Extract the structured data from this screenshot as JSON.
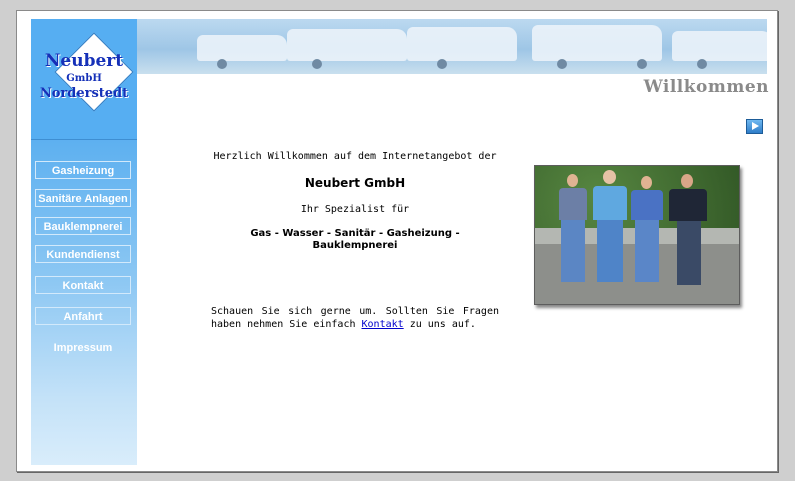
{
  "logo": {
    "line1": "Neubert",
    "line2": "GmbH",
    "line3": "Norderstedt"
  },
  "nav": {
    "items": [
      {
        "label": "Gasheizung"
      },
      {
        "label": "Sanitäre Anlagen"
      },
      {
        "label": "Bauklempnerei"
      },
      {
        "label": "Kundendienst"
      },
      {
        "label": "Kontakt"
      },
      {
        "label": "Anfahrt"
      },
      {
        "label": "Impressum"
      }
    ]
  },
  "page": {
    "title": "Willkommen"
  },
  "content": {
    "welcome": "Herzlich Willkommen auf dem Internetangebot der",
    "company": "Neubert GmbH",
    "specialist": "Ihr Spezialist für",
    "services": "Gas - Wasser - Sanitär - Gasheizung - Bauklempnerei",
    "closing_before": "Schauen Sie sich gerne um. Sollten Sie Fragen haben nehmen Sie einfach ",
    "closing_link": "Kontakt",
    "closing_after": " zu uns auf."
  },
  "colors": {
    "sidebar": "#56aef2",
    "logo_text": "#1530b8",
    "title": "#8a8a8a",
    "link": "#0000cc"
  },
  "icons": {
    "next": "next-arrow-icon"
  }
}
